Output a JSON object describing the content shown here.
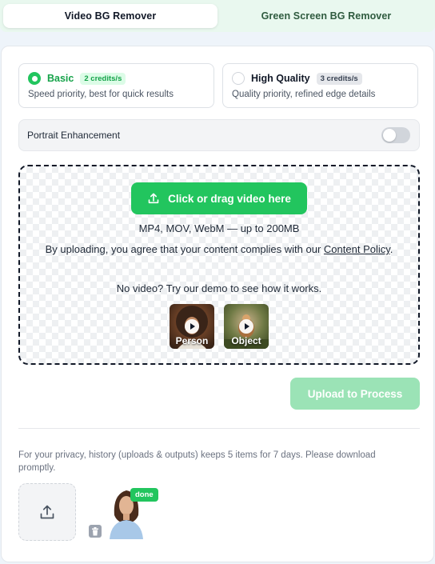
{
  "tabs": [
    {
      "label": "Video BG Remover",
      "active": true
    },
    {
      "label": "Green Screen BG Remover",
      "active": false
    }
  ],
  "modes": {
    "basic": {
      "title": "Basic",
      "badge": "2 credits/s",
      "desc": "Speed priority, best for quick results",
      "selected": true
    },
    "high_quality": {
      "title": "High Quality",
      "badge": "3 credits/s",
      "desc": "Quality priority, refined edge details",
      "selected": false
    }
  },
  "portrait": {
    "label": "Portrait Enhancement",
    "enabled": false
  },
  "upload": {
    "button_label": "Click or drag video here",
    "formats": "MP4, MOV, WebM — up to 200MB",
    "consent_prefix": "By uploading, you agree that your content complies with our ",
    "consent_link": "Content Policy",
    "consent_suffix": ".",
    "demo_text": "No video? Try our demo to see how it works.",
    "demos": [
      "Person",
      "Object"
    ]
  },
  "process_button": "Upload to Process",
  "history": {
    "privacy_note": "For your privacy, history (uploads & outputs) keeps 5 items for 7 days. Please download promptly.",
    "items": [
      {
        "status": "done"
      }
    ]
  },
  "colors": {
    "accent": "#22c55e",
    "accent_disabled": "#9be3b6"
  }
}
